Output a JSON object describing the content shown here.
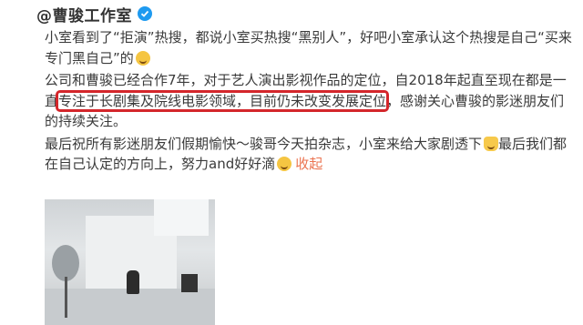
{
  "header": {
    "username": "@曹骏工作室"
  },
  "post": {
    "p1_a": "小室看到了",
    "p1_b": "“拒演”",
    "p1_c": "热搜，都说小室买热搜",
    "p1_d": "“黑别人”",
    "p1_e": "，好吧小室承认这个热搜是自己",
    "p1_f": "“买来专门黑自己”",
    "p1_g": "的",
    "p2_a": "公司和曹骏已经合作7年，对于艺人演出影视作品的定位，自2018年起直至现在都是一直",
    "p2_hl": "专注于长剧集及院线电影领域，目前仍未改变发展定位",
    "p2_b": "，感谢关心曹骏的影迷朋友们的持续关注。",
    "p3_a": "最后祝所有影迷朋友们假期愉快～骏哥今天拍杂志，小室来给大家剧透下",
    "p3_b": "最后我们都在自己认定的方向上，努力and好好滴",
    "collapse": "收起"
  },
  "colors": {
    "accent": "#eb7350",
    "highlight_box": "#d4262b",
    "verified": "#1e9af0"
  },
  "icons": [
    "verified-icon",
    "laugh-emoji-icon",
    "hand-emoji-icon",
    "grin-emoji-icon"
  ]
}
